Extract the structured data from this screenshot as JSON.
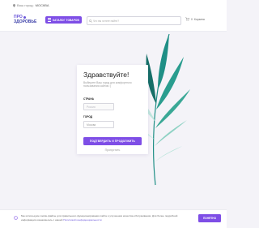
{
  "topbar": {
    "city_prefix": "Ваш город:",
    "city_name": "МОСКВА"
  },
  "header": {
    "logo_line1": "ПРО",
    "logo_line2": "ЗДОРОВЬЕ",
    "catalog_label": "КАТАЛОГ ТОВАРОВ",
    "search_placeholder": "Что вы хотите найти?",
    "cart_label": "Корзина",
    "cart_count": "0"
  },
  "modal": {
    "title": "Здравствуйте!",
    "description": "Выберите Ваш город для комфортного пользования сайтом :)",
    "country_label": "СТРАНА",
    "country_value": "Россия",
    "city_label": "ГОРОД",
    "city_value": "Москва",
    "submit_label": "ПОДТВЕРДИТЬ И ПРОДОЛЖИТЬ",
    "skip_label": "Пропустить"
  },
  "cookie": {
    "text": "Мы используем cookie-файлы для правильного функционирования сайта и улучшения качества обслуживания. Для более подробной информации ознакомьтесь с нашей",
    "link": "Политикой конфиденциальности",
    "button_label": "ПОНЯТНО"
  },
  "colors": {
    "accent": "#7e4ee6",
    "leaf_dark": "#1f8f86",
    "leaf_light": "#a8ddd2"
  }
}
